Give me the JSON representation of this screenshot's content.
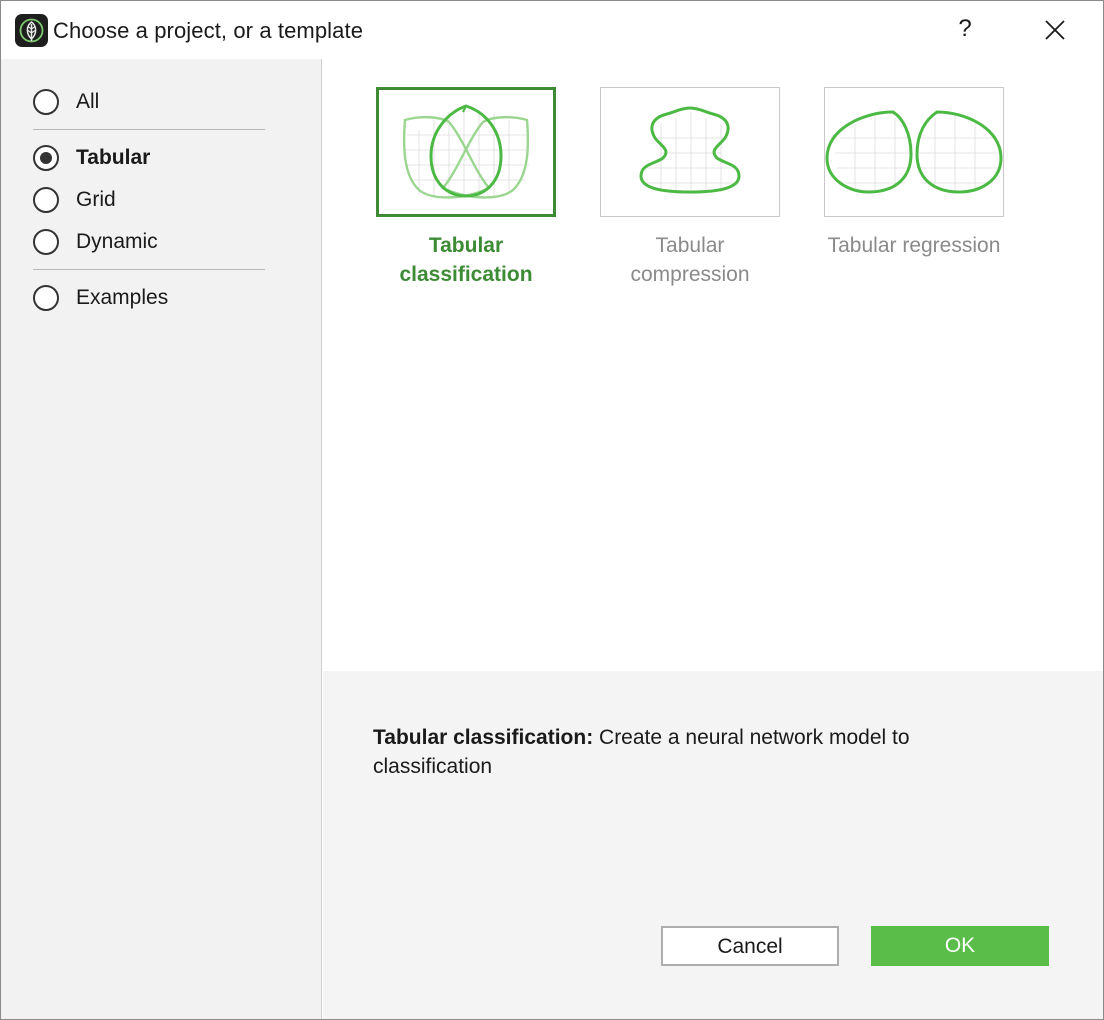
{
  "window": {
    "title": "Choose a project, or a template",
    "help_label": "?"
  },
  "sidebar": {
    "items": [
      {
        "label": "All",
        "checked": false
      },
      {
        "label": "Tabular",
        "checked": true
      },
      {
        "label": "Grid",
        "checked": false
      },
      {
        "label": "Dynamic",
        "checked": false
      },
      {
        "label": "Examples",
        "checked": false
      }
    ]
  },
  "templates": [
    {
      "line1": "Tabular",
      "line2": "classification",
      "icon": "tabular-classification-icon",
      "selected": true
    },
    {
      "line1": "Tabular",
      "line2": "compression",
      "icon": "tabular-compression-icon",
      "selected": false
    },
    {
      "line1": "Tabular regression",
      "line2": "",
      "icon": "tabular-regression-icon",
      "selected": false
    }
  ],
  "description": {
    "title": "Tabular classification",
    "separator": ":",
    "text": " Create a neural network model to classification"
  },
  "buttons": {
    "cancel": "Cancel",
    "ok": "OK"
  },
  "colors": {
    "accent": "#3d8c35",
    "ok_button": "#5abd4a",
    "icon_stroke": "#4cb944",
    "icon_stroke_light": "#9ad68f",
    "sidebar_bg": "#f2f2f2",
    "bottom_bg": "#f4f4f4"
  }
}
